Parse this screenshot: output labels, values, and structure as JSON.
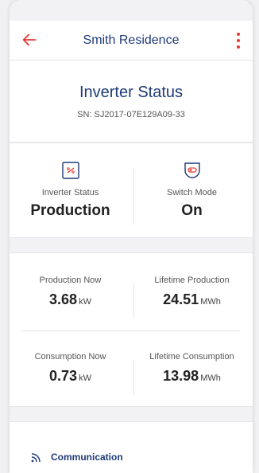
{
  "header": {
    "title": "Smith Residence",
    "back_icon": "arrow-left-icon",
    "menu_icon": "more-vertical-icon"
  },
  "hero": {
    "title": "Inverter Status",
    "serial": "SN: SJ2017-07E129A09-33"
  },
  "status": {
    "inverter": {
      "icon": "inverter-icon",
      "label": "Inverter Status",
      "value": "Production"
    },
    "switch": {
      "icon": "switch-icon",
      "label": "Switch Mode",
      "value": "On"
    }
  },
  "metrics": {
    "production_now": {
      "label": "Production Now",
      "value": "3.68",
      "unit": "kW"
    },
    "lifetime_production": {
      "label": "Lifetime Production",
      "value": "24.51",
      "unit": "MWh"
    },
    "consumption_now": {
      "label": "Consumption Now",
      "value": "0.73",
      "unit": "kW"
    },
    "lifetime_consumption": {
      "label": "Lifetime Consumption",
      "value": "13.98",
      "unit": "MWh"
    }
  },
  "communication": {
    "icon": "signal-icon",
    "label": "Communication"
  },
  "colors": {
    "accent": "#e53935",
    "navy": "#1f3a78",
    "text": "#222222",
    "muted": "#555555"
  }
}
